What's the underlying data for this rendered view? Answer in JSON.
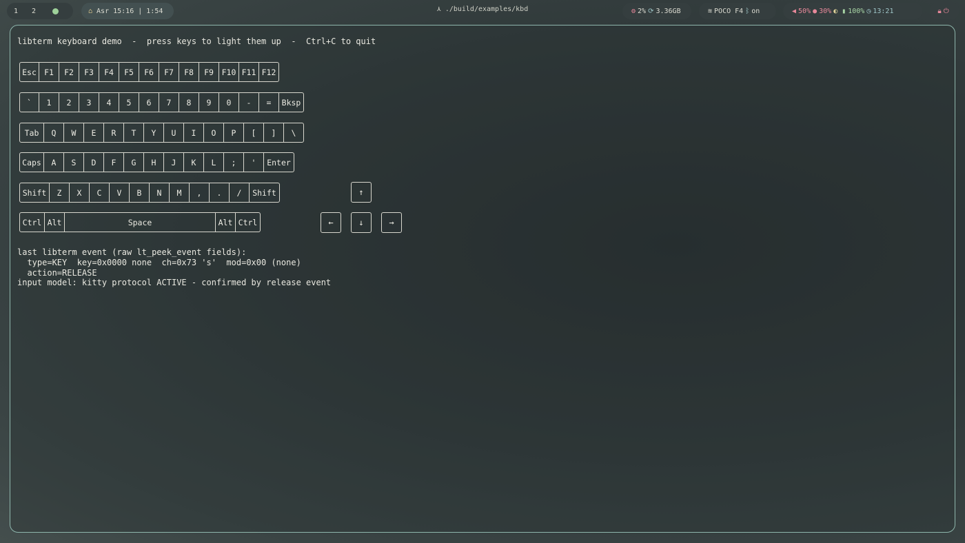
{
  "topbar": {
    "workspaces": [
      "1",
      "2"
    ],
    "prayer": "Asr 15:16 | 1:54",
    "window_title": "./build/examples/kbd",
    "system": {
      "cpu": "2%",
      "memory": "3.36GB"
    },
    "network": {
      "ssid": "POCO F4",
      "bluetooth": "on"
    },
    "audio": {
      "volume": "50%",
      "mic": "30%",
      "battery": "100%",
      "clock": "13:21"
    }
  },
  "terminal": {
    "header": "libterm keyboard demo  -  press keys to light them up  -  Ctrl+C to quit",
    "rows": [
      [
        "Esc",
        "F1",
        "F2",
        "F3",
        "F4",
        "F5",
        "F6",
        "F7",
        "F8",
        "F9",
        "F10",
        "F11",
        "F12"
      ],
      [
        "`",
        "1",
        "2",
        "3",
        "4",
        "5",
        "6",
        "7",
        "8",
        "9",
        "0",
        "-",
        "=",
        "Bksp"
      ],
      [
        "Tab",
        "Q",
        "W",
        "E",
        "R",
        "T",
        "Y",
        "U",
        "I",
        "O",
        "P",
        "[",
        "]",
        "\\"
      ],
      [
        "Caps",
        "A",
        "S",
        "D",
        "F",
        "G",
        "H",
        "J",
        "K",
        "L",
        ";",
        "'",
        "Enter"
      ],
      [
        "Shift",
        "Z",
        "X",
        "C",
        "V",
        "B",
        "N",
        "M",
        ",",
        ".",
        "/",
        "Shift"
      ],
      [
        "Ctrl",
        "Alt",
        "Space",
        "Alt",
        "Ctrl"
      ]
    ],
    "arrows": {
      "up": "↑",
      "left": "←",
      "down": "↓",
      "right": "→"
    },
    "event_lines": [
      "last libterm event (raw lt_peek_event fields):",
      "  type=KEY  key=0x0000 none  ch=0x73 's'  mod=0x00 (none)",
      "  action=RELEASE",
      "input model: kitty protocol ACTIVE - confirmed by release event"
    ]
  }
}
